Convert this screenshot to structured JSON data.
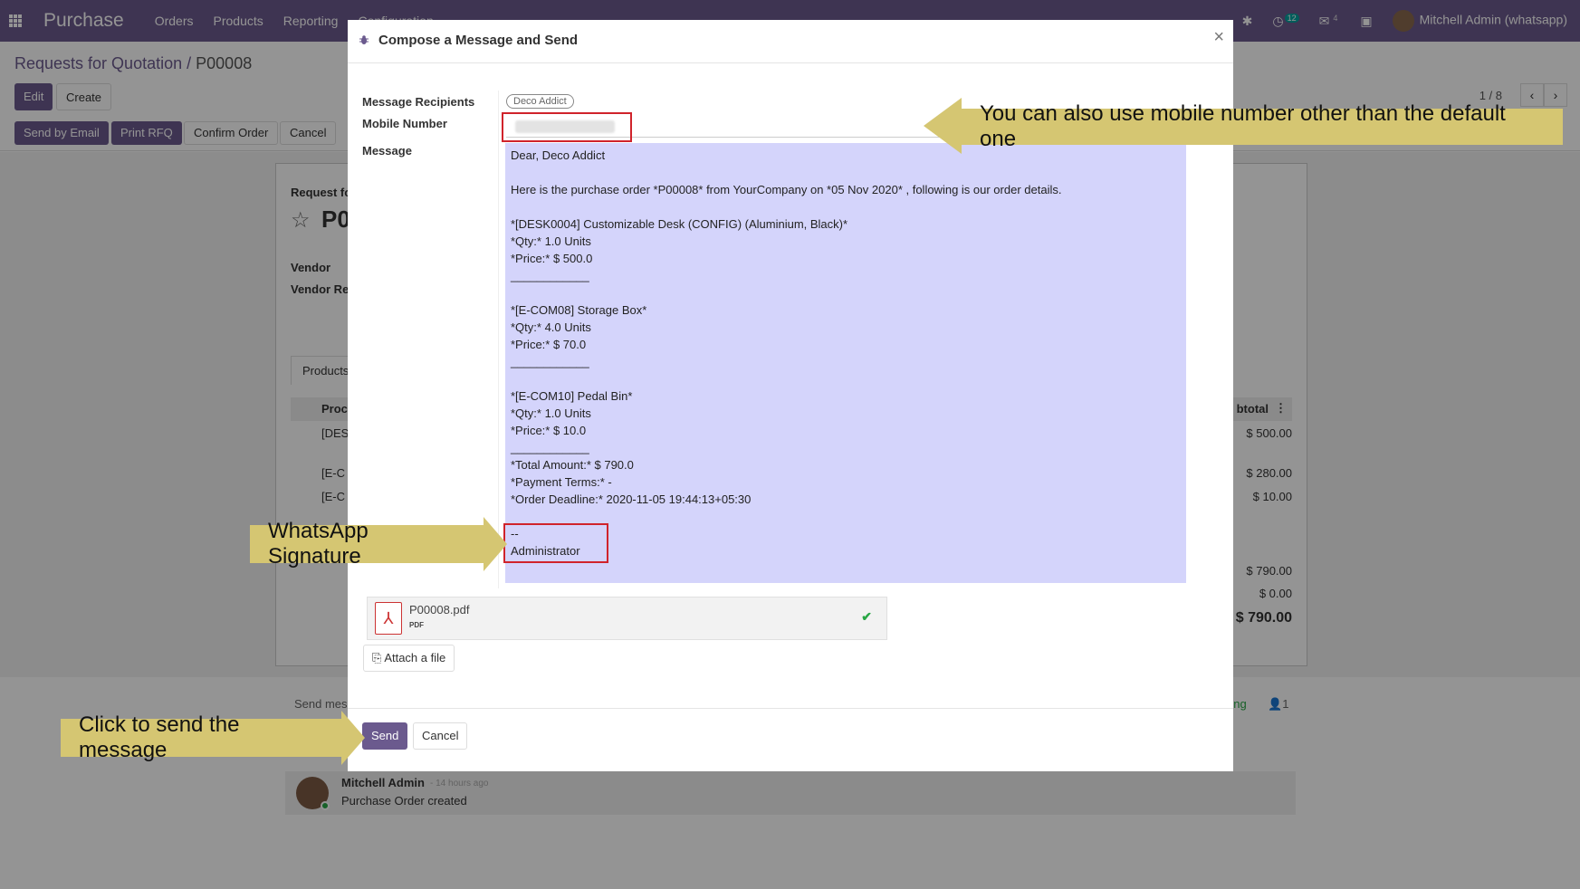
{
  "topbar": {
    "app_name": "Purchase",
    "menu": [
      "Orders",
      "Products",
      "Reporting",
      "Configuration"
    ],
    "activity_count": "12",
    "messages_count": "4",
    "user": "Mitchell Admin (whatsapp)"
  },
  "control_panel": {
    "breadcrumb_parent": "Requests for Quotation",
    "breadcrumb_sep": "/",
    "breadcrumb_current": "P00008",
    "edit_label": "Edit",
    "create_label": "Create",
    "send_email_label": "Send by Email",
    "print_rfq_label": "Print RFQ",
    "confirm_label": "Confirm Order",
    "cancel_label": "Cancel",
    "pager": "1 / 8"
  },
  "form": {
    "request_label": "Request fo",
    "title": "P0",
    "vendor_label": "Vendor",
    "vendor_ref_label": "Vendor Re",
    "tab_products": "Products",
    "col_product": "Proc",
    "col_subtotal": "btotal",
    "rows": [
      {
        "product": "[DES",
        "subtotal": "$ 500.00"
      },
      {
        "product": "[E-C",
        "subtotal": "$ 280.00"
      },
      {
        "product": "[E-C",
        "subtotal": "$ 10.00"
      }
    ],
    "untaxed": "$ 790.00",
    "taxes": "$ 0.00",
    "total": "$ 790.00"
  },
  "chatter": {
    "send_message": "Send mes",
    "following": "wing",
    "followers": "1",
    "author": "Mitchell Admin",
    "time": "- 14 hours ago",
    "body": "Purchase Order created"
  },
  "modal": {
    "title": "Compose a Message and Send",
    "close": "×",
    "recipients_label": "Message Recipients",
    "recipient_tag": "Deco Addict",
    "mobile_label": "Mobile Number",
    "message_label": "Message",
    "message_body": "Dear, Deco Addict\n\nHere is the purchase order *P00008* from YourCompany on *05 Nov 2020* , following is our order details.\n\n*[DESK0004] Customizable Desk (CONFIG) (Aluminium, Black)*\n*Qty:* 1.0 Units\n*Price:* $ 500.0\n____________\n\n*[E-COM08] Storage Box*\n*Qty:* 4.0 Units\n*Price:* $ 70.0\n____________\n\n*[E-COM10] Pedal Bin*\n*Qty:* 1.0 Units\n*Price:* $ 10.0\n____________\n*Total Amount:* $ 790.0\n*Payment Terms:* -\n*Order Deadline:* 2020-11-05 19:44:13+05:30\n\n--\nAdministrator",
    "attachment_name": "P00008.pdf",
    "attachment_type": "PDF",
    "attach_label": "Attach a file",
    "send_label": "Send",
    "cancel_label": "Cancel"
  },
  "callouts": {
    "mobile_hint": "You can also use mobile number other than the default one",
    "signature_hint": "WhatsApp Signature",
    "send_hint": "Click to send the message"
  },
  "colors": {
    "brand": "#6b5a8e",
    "message_bg": "#d4d4fb",
    "callout": "#d5c672",
    "highlight": "#d0232b"
  }
}
